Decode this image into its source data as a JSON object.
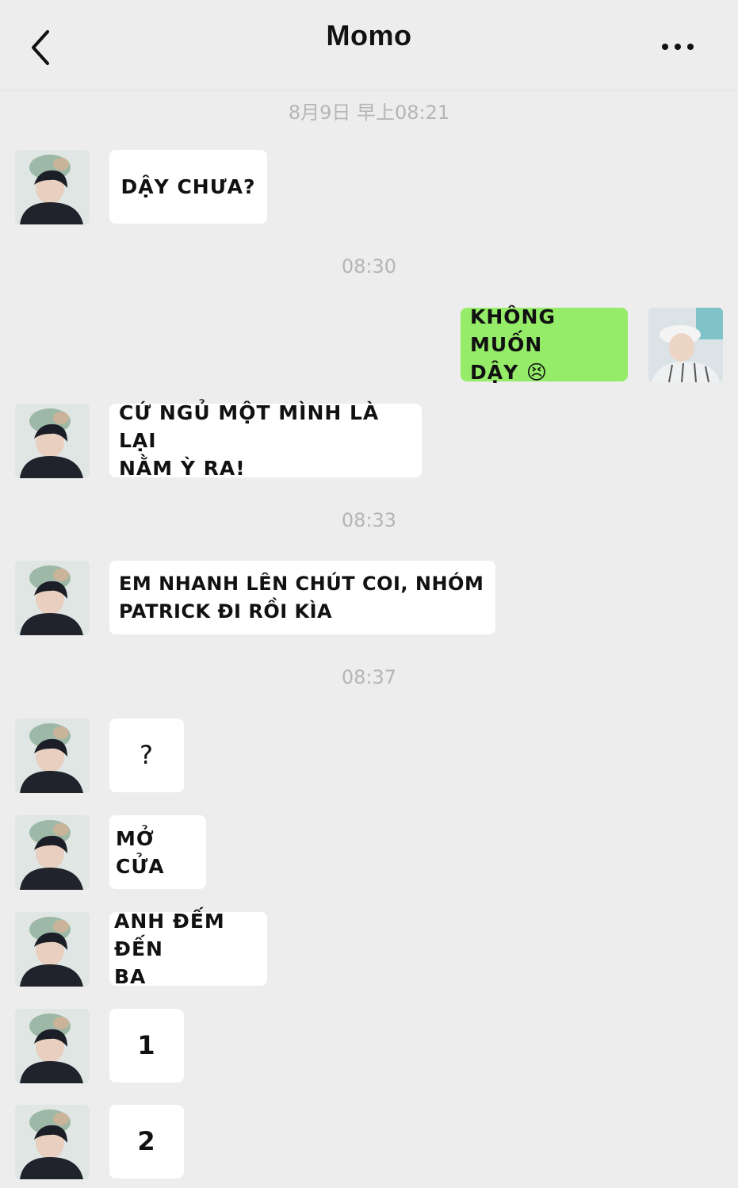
{
  "header": {
    "title": "Momo"
  },
  "timestamps": [
    "8月9日 早上08:21",
    "08:30",
    "08:33",
    "08:37"
  ],
  "messages": [
    {
      "text": "DẬY CHƯA?"
    },
    {
      "text": "KHÔNG MUỐN\nDẬY 😣"
    },
    {
      "text": "CỨ NGỦ MỘT MÌNH LÀ LẠI\nNẰM Ỳ RA!"
    },
    {
      "text": "EM NHANH LÊN CHÚT COI, NHÓM\nPATRICK ĐI RỒI KÌA"
    },
    {
      "text": "?"
    },
    {
      "text": "MỞ CỬA"
    },
    {
      "text": "ANH ĐẾM ĐẾN\nBA"
    },
    {
      "text": "1"
    },
    {
      "text": "2"
    }
  ],
  "colors": {
    "background": "#ededed",
    "own_bubble": "#95ec69",
    "other_bubble": "#ffffff",
    "timestamp": "#b5b5b5"
  },
  "icons": [
    "back-chevron-icon",
    "more-dots-icon"
  ]
}
